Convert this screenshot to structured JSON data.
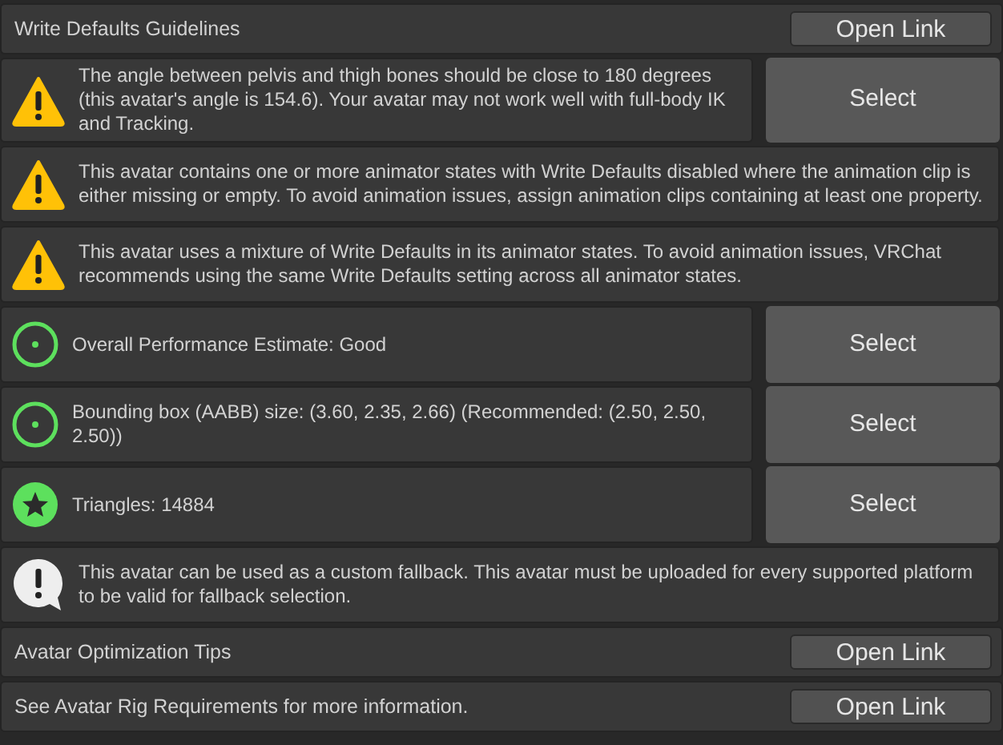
{
  "items": [
    {
      "kind": "link",
      "text": "Write Defaults Guidelines",
      "button": "Open Link"
    },
    {
      "kind": "warning",
      "text": "The angle between pelvis and thigh bones should be close to 180 degrees (this avatar's angle is 154.6). Your avatar may not work well with full-body IK and Tracking.",
      "button": "Select"
    },
    {
      "kind": "warning",
      "text": "This avatar contains one or more animator states with Write Defaults disabled where the animation clip is either missing or empty. To avoid animation issues, assign animation clips containing at least one property."
    },
    {
      "kind": "warning",
      "text": "This avatar uses a mixture of Write Defaults in its animator states. To avoid animation issues, VRChat recommends using the same Write Defaults setting across all animator states."
    },
    {
      "kind": "good",
      "text": "Overall Performance Estimate: Good",
      "button": "Select"
    },
    {
      "kind": "good",
      "text": "Bounding box (AABB) size: (3.60, 2.35, 2.66) (Recommended: (2.50, 2.50, 2.50))",
      "button": "Select"
    },
    {
      "kind": "excellent",
      "text": "Triangles: 14884",
      "button": "Select"
    },
    {
      "kind": "info",
      "text": "This avatar can be used as a custom fallback. This avatar must be uploaded for every supported platform to be valid for fallback selection."
    },
    {
      "kind": "link",
      "text": "Avatar Optimization Tips",
      "button": "Open Link"
    },
    {
      "kind": "link",
      "text": "See Avatar Rig Requirements for more information.",
      "button": "Open Link"
    }
  ]
}
